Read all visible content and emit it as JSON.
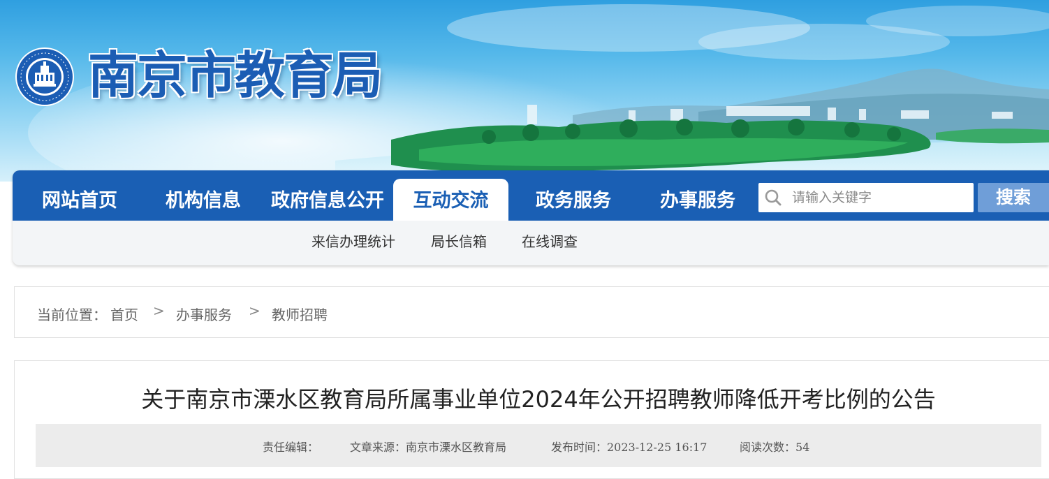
{
  "header": {
    "site_title": "南京市教育局",
    "emblem_icon": "nanjing-education-emblem-icon",
    "colors": {
      "brand_blue": "#1a5fb4",
      "search_button": "#6f9ed8"
    }
  },
  "nav": {
    "items": [
      {
        "label": "网站首页"
      },
      {
        "label": "机构信息"
      },
      {
        "label": "政府信息公开"
      },
      {
        "label": "互动交流",
        "active": true
      },
      {
        "label": "政务服务"
      },
      {
        "label": "办事服务"
      }
    ],
    "search": {
      "placeholder": "请输入关键字",
      "icon": "search-icon",
      "button_label": "搜索"
    },
    "subnav": [
      {
        "label": "来信办理统计"
      },
      {
        "label": "局长信箱"
      },
      {
        "label": "在线调查"
      }
    ]
  },
  "breadcrumb": {
    "prefix": "当前位置：",
    "items": [
      "首页",
      "办事服务",
      "教师招聘"
    ],
    "separator": ">"
  },
  "article": {
    "title": "关于南京市溧水区教育局所属事业单位2024年公开招聘教师降低开考比例的公告",
    "meta": {
      "editor": "责任编辑：",
      "source": "文章来源：南京市溧水区教育局",
      "published": "发布时间：2023-12-25 16:17",
      "views": "阅读次数：54"
    }
  }
}
